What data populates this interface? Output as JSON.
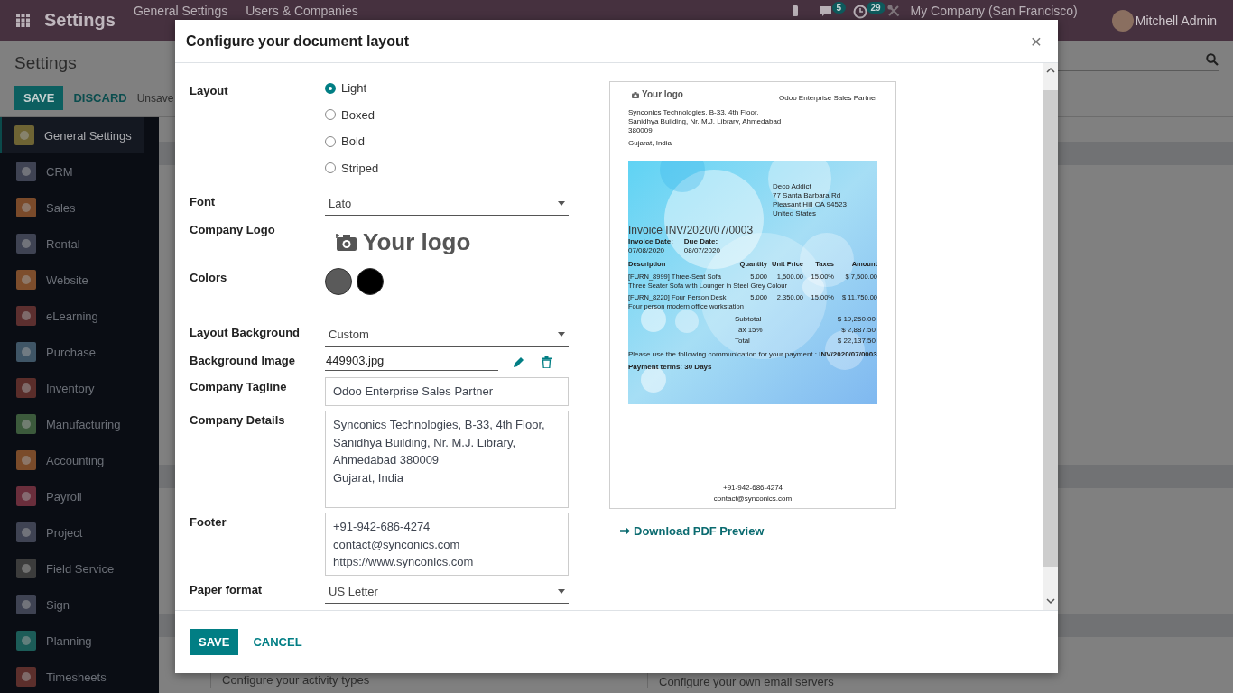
{
  "top_bar": {
    "app_title": "Settings",
    "menu": [
      "General Settings",
      "Users & Companies"
    ],
    "chat_count": "5",
    "activity_count": "29",
    "company": "My Company (San Francisco)",
    "user": "Mitchell Admin"
  },
  "control_panel": {
    "title": "Settings",
    "save": "SAVE",
    "discard": "DISCARD",
    "status": "Unsave"
  },
  "sidebar": {
    "items": [
      {
        "label": "General Settings",
        "selected": true,
        "color": "#6e6434"
      },
      {
        "label": "CRM",
        "selected": false,
        "color": "#3f4353"
      },
      {
        "label": "Sales",
        "selected": false,
        "color": "#7a4a2a"
      },
      {
        "label": "Rental",
        "selected": false,
        "color": "#3f4353"
      },
      {
        "label": "Website",
        "selected": false,
        "color": "#7d4d2c"
      },
      {
        "label": "eLearning",
        "selected": false,
        "color": "#5c2f2f"
      },
      {
        "label": "Purchase",
        "selected": false,
        "color": "#3f5566"
      },
      {
        "label": "Inventory",
        "selected": false,
        "color": "#5a2d2a"
      },
      {
        "label": "Manufacturing",
        "selected": false,
        "color": "#3c5a3c"
      },
      {
        "label": "Accounting",
        "selected": false,
        "color": "#7a4b2a"
      },
      {
        "label": "Payroll",
        "selected": false,
        "color": "#6a2e3c"
      },
      {
        "label": "Project",
        "selected": false,
        "color": "#3f4353"
      },
      {
        "label": "Field Service",
        "selected": false,
        "color": "#3c3c3c"
      },
      {
        "label": "Sign",
        "selected": false,
        "color": "#3f4353"
      },
      {
        "label": "Planning",
        "selected": false,
        "color": "#1c5c58"
      },
      {
        "label": "Timesheets",
        "selected": false,
        "color": "#5c2f2c"
      }
    ]
  },
  "background_cards": [
    "Configure your activity types",
    "Configure your own email servers"
  ],
  "dialog": {
    "title": "Configure your document layout",
    "close": "×",
    "fields": [
      {
        "kind": "radio",
        "label": "Layout",
        "options": [
          {
            "label": "Light",
            "selected": true
          },
          {
            "label": "Boxed",
            "selected": false
          },
          {
            "label": "Bold",
            "selected": false
          },
          {
            "label": "Striped",
            "selected": false
          }
        ]
      },
      {
        "kind": "select",
        "label": "Font",
        "value": "Lato"
      },
      {
        "kind": "logo",
        "label": "Company Logo",
        "value": "Your logo"
      },
      {
        "kind": "colors",
        "label": "Colors",
        "colors": [
          {
            "color": "#5a5a5a"
          },
          {
            "color": "#000000"
          }
        ]
      },
      {
        "kind": "select",
        "label": "Layout Background",
        "value": "Custom"
      },
      {
        "kind": "file",
        "label": "Background Image",
        "value": "449903.jpg"
      },
      {
        "kind": "text",
        "label": "Company Tagline",
        "value": "Odoo Enterprise Sales Partner"
      },
      {
        "kind": "textarea",
        "label": "Company Details",
        "lines": [
          "Synconics Technologies, B-33, 4th Floor,",
          "Sanidhya Building, Nr. M.J. Library,",
          "Ahmedabad 380009",
          "Gujarat, India"
        ]
      },
      {
        "kind": "textarea",
        "label": "Footer",
        "lines": [
          "+91-942-686-4274",
          "contact@synconics.com",
          "https://www.synconics.com"
        ]
      },
      {
        "kind": "select",
        "label": "Paper format",
        "value": "US Letter"
      }
    ],
    "preview": {
      "logo": "Your logo",
      "tagline": "Odoo Enterprise Sales Partner",
      "company_address": [
        "Synconics Technologies, B-33, 4th Floor,",
        "Sanidhya Building, Nr. M.J. Library, Ahmedabad",
        "380009"
      ],
      "company_region": "Gujarat, India",
      "customer": [
        "Deco Addict",
        "77 Santa Barbara Rd",
        "Pleasant Hill CA 94523",
        "United States"
      ],
      "invoice_title": "Invoice INV/2020/07/0003",
      "dates": [
        {
          "label": "Invoice Date:",
          "value": "07/08/2020"
        },
        {
          "label": "Due Date:",
          "value": "08/07/2020"
        }
      ],
      "columns": [
        "Description",
        "Quantity",
        "Unit Price",
        "Taxes",
        "Amount"
      ],
      "lines": [
        {
          "cells": [
            "[FURN_8999] Three-Seat Sofa",
            "5.000",
            "1,500.00",
            "15.00%",
            "$ 7,500.00"
          ],
          "note": "Three Seater Sofa with Lounger in Steel Grey Colour"
        },
        {
          "cells": [
            "[FURN_8220] Four Person Desk",
            "5.000",
            "2,350.00",
            "15.00%",
            "$ 11,750.00"
          ],
          "note": "Four person modern office workstation"
        }
      ],
      "totals": [
        {
          "label": "Subtotal",
          "value": "$ 19,250.00"
        },
        {
          "label": "Tax 15%",
          "value": "$ 2,887.50"
        },
        {
          "label": "Total",
          "value": "$ 22,137.50"
        }
      ],
      "communication": "Please use the following communication for your payment : **INV/2020/07/0003**",
      "payment_terms": "Payment terms: 30 Days",
      "footer": [
        "+91-942-686-4274",
        "contact@synconics.com"
      ]
    },
    "download_link": "Download PDF Preview",
    "buttons": {
      "save": "SAVE",
      "cancel": "CANCEL"
    }
  }
}
